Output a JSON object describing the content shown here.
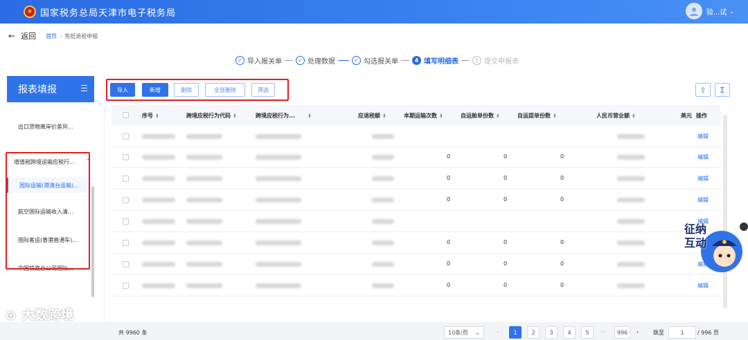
{
  "header": {
    "title": "国家税务总局天津市电子税务局",
    "user": "验...试",
    "logo_icon": "tax-emblem-icon"
  },
  "nav": {
    "back": "返回",
    "home": "首页",
    "current": "免抵退税申报"
  },
  "steps": [
    {
      "label": "导入报关单",
      "state": "done"
    },
    {
      "label": "处理数据",
      "state": "done"
    },
    {
      "label": "勾选报关单",
      "state": "done"
    },
    {
      "num": "4",
      "label": "填写明细表",
      "state": "active"
    },
    {
      "num": "5",
      "label": "提交申报表",
      "state": "todo"
    }
  ],
  "sidebar": {
    "title": "报表填报",
    "items": [
      "出口货物离岸价差异...",
      "增值税跨境运输应税行...",
      "国际运输(港澳台运输)...",
      "航空国际运输收入清...",
      "国际客运(香港直通车)...",
      "中国铁路总公司国际..."
    ]
  },
  "toolbar": {
    "import": "导入",
    "add": "新增",
    "delete": "删除",
    "delete_all": "全部删除",
    "filter": "筛选",
    "export_icon": "export-icon",
    "sum_icon": "sigma-icon",
    "sum": "Σ"
  },
  "table": {
    "columns": [
      "序号",
      "跨境应税行为代码",
      "跨境应税行为...",
      "应退税额",
      "本期运输次数",
      "自运舱单份数",
      "自运提单份数",
      "人民币营业额",
      "美元",
      "操作"
    ],
    "rows": [
      {
        "trips": "",
        "cabin": "",
        "bill": "",
        "action": "编辑"
      },
      {
        "trips": "0",
        "cabin": "0",
        "bill": "0",
        "action": "编辑"
      },
      {
        "trips": "0",
        "cabin": "0",
        "bill": "0",
        "action": "编辑"
      },
      {
        "trips": "0",
        "cabin": "0",
        "bill": "0",
        "action": "编辑"
      },
      {
        "trips": "",
        "cabin": "",
        "bill": "",
        "action": "编辑"
      },
      {
        "trips": "0",
        "cabin": "0",
        "bill": "0",
        "action": "编辑"
      },
      {
        "trips": "0",
        "cabin": "0",
        "bill": "0",
        "action": "编辑"
      },
      {
        "trips": "0",
        "cabin": "0",
        "bill": "0",
        "action": "编辑"
      }
    ]
  },
  "pager": {
    "total": "共 9960 条",
    "page_size": "10条/页",
    "pages": [
      "1",
      "2",
      "3",
      "4",
      "5",
      "···",
      "996"
    ],
    "jump_label": "跳至",
    "jump_value": "1",
    "total_pages": "/ 996 页"
  },
  "watermark": "大数跨境",
  "mascot": {
    "text": "征纳互动"
  }
}
